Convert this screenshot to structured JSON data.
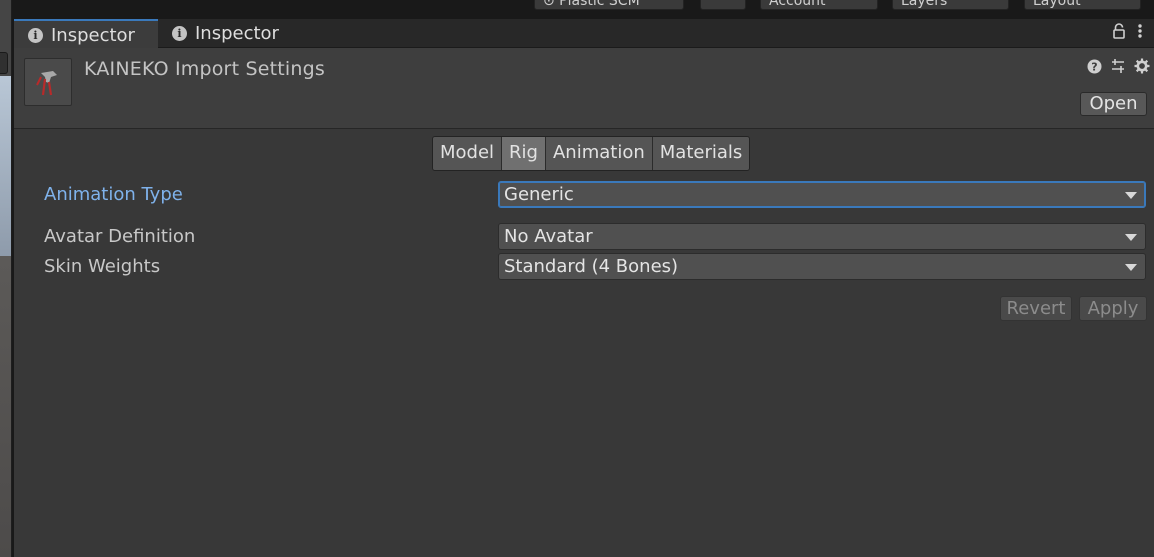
{
  "toolbar": {
    "plastic_label": "⊙ Plastic SCM",
    "account_label": "Account",
    "layers_label": "Layers",
    "layout_label": "Layout"
  },
  "tabs": [
    {
      "label": "Inspector",
      "active": true,
      "icon": "info-icon"
    },
    {
      "label": "Inspector",
      "active": false,
      "icon": "info-icon"
    }
  ],
  "header": {
    "title": "KAINEKO Import Settings",
    "open_label": "Open",
    "icons": [
      "help-icon",
      "preset-icon",
      "settings-icon"
    ]
  },
  "section_tabs": [
    {
      "label": "Model",
      "active": false
    },
    {
      "label": "Rig",
      "active": true
    },
    {
      "label": "Animation",
      "active": false
    },
    {
      "label": "Materials",
      "active": false
    }
  ],
  "properties": {
    "animation_type": {
      "label": "Animation Type",
      "value": "Generic"
    },
    "avatar_definition": {
      "label": "Avatar Definition",
      "value": "No Avatar"
    },
    "skin_weights": {
      "label": "Skin Weights",
      "value": "Standard (4 Bones)"
    }
  },
  "actions": {
    "revert_label": "Revert",
    "apply_label": "Apply"
  },
  "colors": {
    "accent": "#3a79bb",
    "focused_label": "#7fb2eb",
    "panel_bg": "#383838"
  }
}
